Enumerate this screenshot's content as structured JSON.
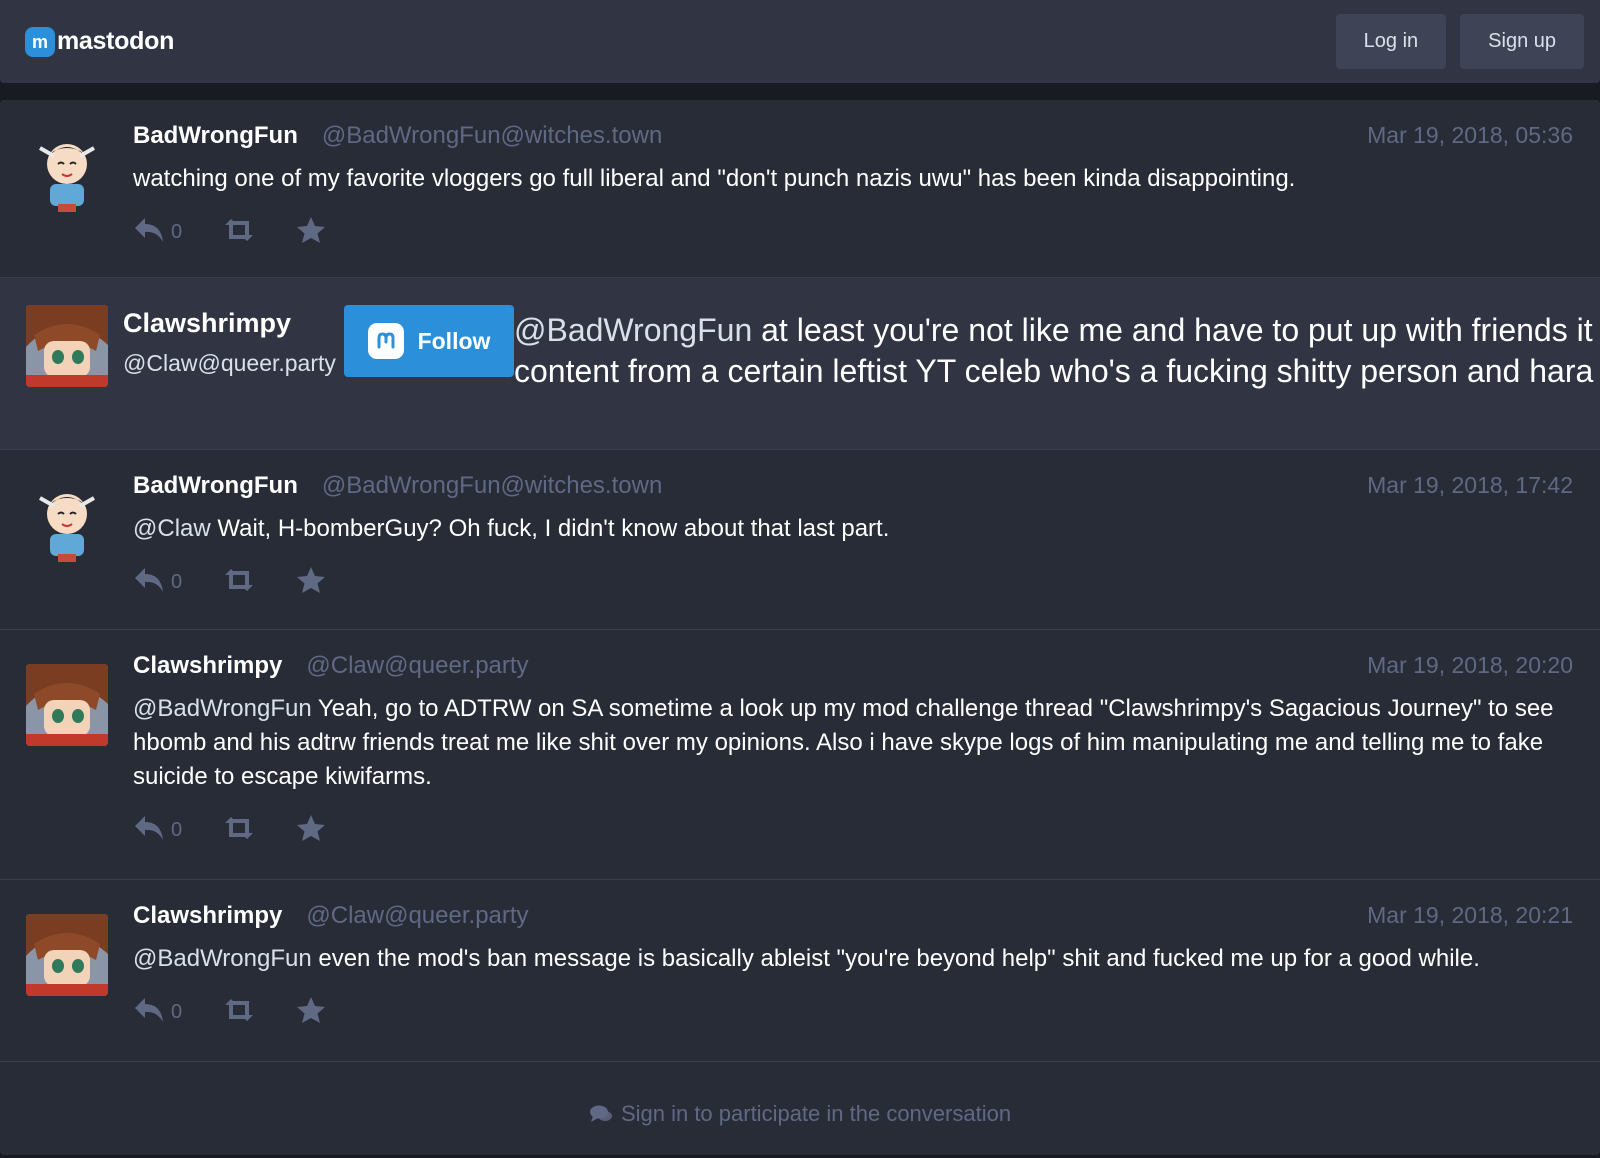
{
  "header": {
    "logo_mark": "m",
    "logo_text": "mastodon",
    "login_label": "Log in",
    "signup_label": "Sign up"
  },
  "posts": [
    {
      "name": "BadWrongFun",
      "handle": "@BadWrongFun@witches.town",
      "time": "Mar 19, 2018, 05:36",
      "mention": "",
      "text": "watching one of my favorite vloggers go full liberal and \"don't punch nazis uwu\" has been kinda disappointing.",
      "reply_count": "0"
    },
    {
      "name": "BadWrongFun",
      "handle": "@BadWrongFun@witches.town",
      "time": "Mar 19, 2018, 17:42",
      "mention": "@Claw",
      "text": " Wait, H-bomberGuy? Oh fuck, I didn't know about that last part.",
      "reply_count": "0"
    },
    {
      "name": "Clawshrimpy",
      "handle": "@Claw@queer.party",
      "time": "Mar 19, 2018, 20:20",
      "mention": "@BadWrongFun",
      "text": " Yeah, go to ADTRW on SA sometime a look up my mod challenge thread \"Clawshrimpy's Sagacious Journey\" to see hbomb and his adtrw friends treat me like shit over my opinions. Also i have skype logs of him manipulating me and telling me to fake suicide to escape kiwifarms.",
      "reply_count": "0"
    },
    {
      "name": "Clawshrimpy",
      "handle": "@Claw@queer.party",
      "time": "Mar 19, 2018, 20:21",
      "mention": "@BadWrongFun",
      "text": " even the mod's ban message is basically ableist \"you're beyond help\" shit and fucked me up for a good while.",
      "reply_count": "0"
    }
  ],
  "focused": {
    "name": "Clawshrimpy",
    "handle": "@Claw@queer.party",
    "follow_label": "Follow",
    "mention": "@BadWrongFun",
    "line1": " at least you're not like me and have to put up with friends it",
    "line2": "content from a certain leftist YT celeb who's a fucking shitty person and hara"
  },
  "footer": {
    "cta_label": "Sign in to participate in the conversation"
  },
  "colors": {
    "accent": "#2b90d9",
    "background": "#191b22",
    "panel": "#282c37",
    "muted": "#606984"
  },
  "icons": [
    "reply-icon",
    "boost-icon",
    "favourite-icon",
    "comments-icon",
    "mastodon-logo-icon"
  ]
}
